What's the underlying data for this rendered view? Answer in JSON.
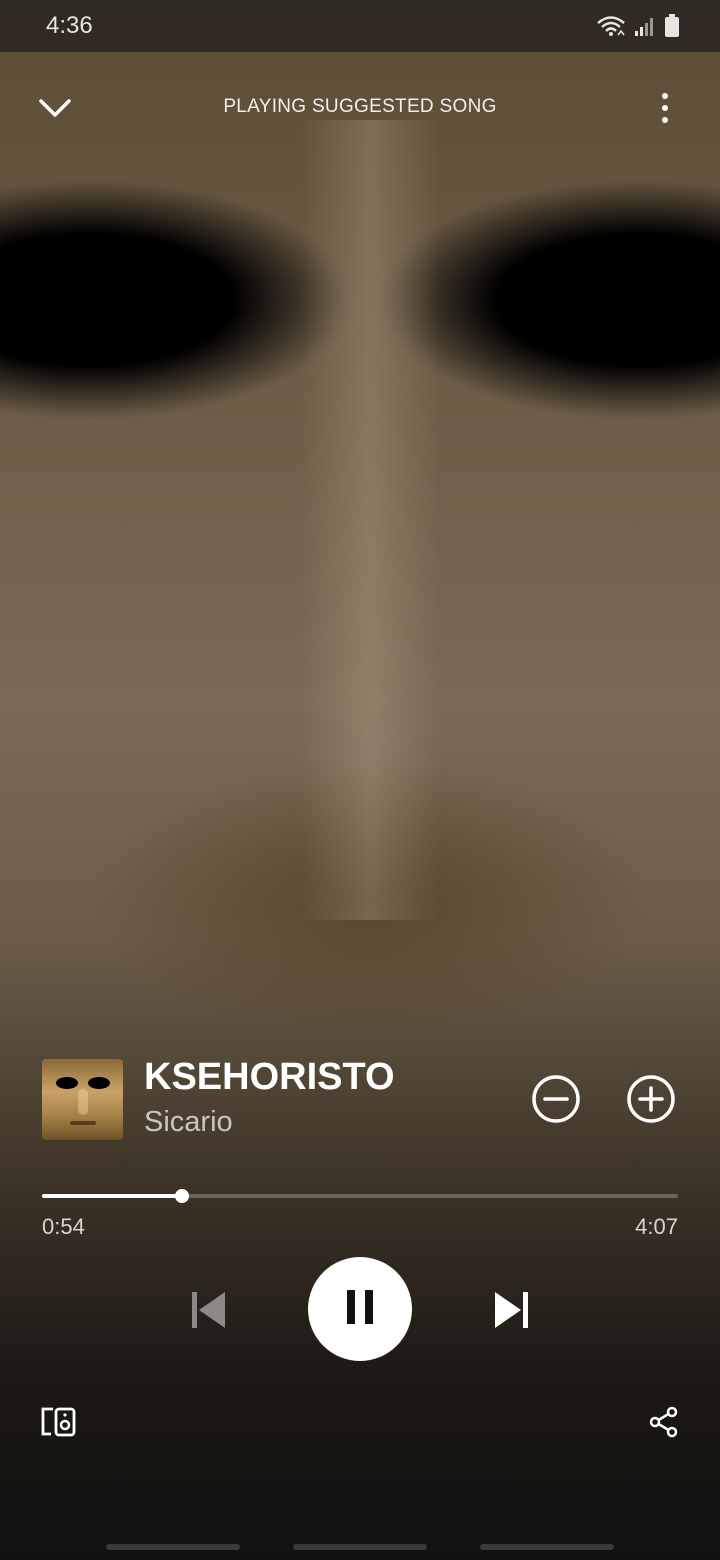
{
  "status_bar": {
    "time": "4:36",
    "icons": [
      "wifi-icon",
      "signal-icon",
      "battery-icon"
    ]
  },
  "header": {
    "title": "PLAYING SUGGESTED SONG",
    "collapse_icon": "chevron-down-icon",
    "menu_icon": "more-vertical-icon"
  },
  "track": {
    "title": "KSEHORISTO",
    "artist": "Sicario",
    "artwork": "album-art-mask"
  },
  "progress": {
    "elapsed": "0:54",
    "total": "4:07",
    "fraction": 0.22
  },
  "controls": {
    "previous": "skip-previous-icon",
    "play_pause": "pause-icon",
    "next": "skip-next-icon",
    "remove": "minus-circle-icon",
    "add": "plus-circle-icon",
    "devices": "connect-device-icon",
    "share": "share-icon"
  },
  "colors": {
    "accent": "#ffffff",
    "muted_text": "#c9c6c0",
    "disabled_icon": "#8c8a86"
  }
}
